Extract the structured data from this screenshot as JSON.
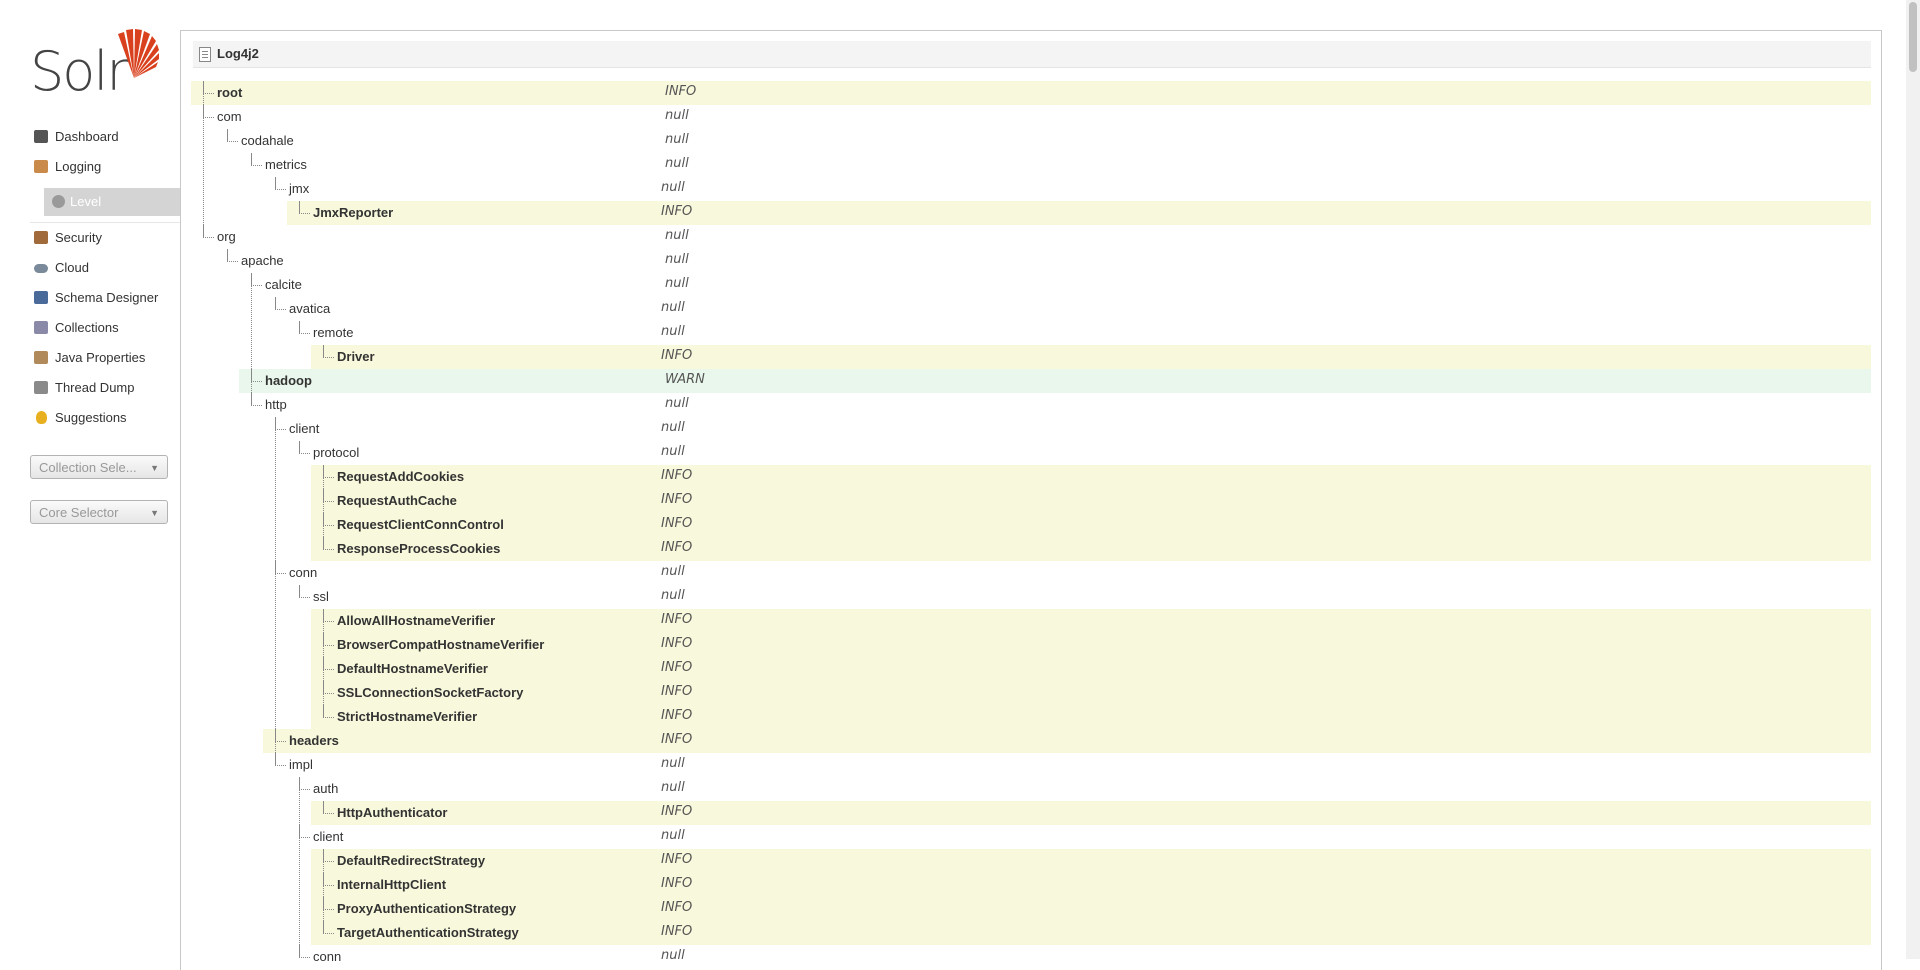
{
  "logo": {
    "text": "Solr"
  },
  "nav": [
    {
      "name": "nav-dashboard",
      "label": "Dashboard",
      "icon": "dashboard-icon",
      "color": "#555555"
    },
    {
      "name": "nav-logging",
      "label": "Logging",
      "icon": "logging-icon",
      "color": "#c98a4a"
    },
    {
      "name": "nav-level",
      "label": "Level",
      "icon": "gear-icon",
      "sub": true
    },
    {
      "name": "nav-security",
      "label": "Security",
      "icon": "security-icon",
      "color": "#a06a3a"
    },
    {
      "name": "nav-cloud",
      "label": "Cloud",
      "icon": "cloud-icon",
      "color": "#7a8a9a"
    },
    {
      "name": "nav-schema-designer",
      "label": "Schema Designer",
      "icon": "book-icon",
      "color": "#4a6a9a"
    },
    {
      "name": "nav-collections",
      "label": "Collections",
      "icon": "collections-icon",
      "color": "#8a8aa8"
    },
    {
      "name": "nav-java-properties",
      "label": "Java Properties",
      "icon": "java-icon",
      "color": "#b08a5a"
    },
    {
      "name": "nav-thread-dump",
      "label": "Thread Dump",
      "icon": "thread-dump-icon",
      "color": "#8a8a8a"
    },
    {
      "name": "nav-suggestions",
      "label": "Suggestions",
      "icon": "lightbulb-icon",
      "color": "#e8b020"
    }
  ],
  "selectors": {
    "collection": "Collection Sele...",
    "core": "Core Selector"
  },
  "panel": {
    "title": "Log4j2"
  },
  "colors": {
    "accent": "#d9411e",
    "set_row": "#f8f8dc",
    "warn_row": "#e9f7ec"
  },
  "tree": [
    {
      "label": "root",
      "level": "INFO",
      "depth": 0,
      "set": true,
      "hl": "set"
    },
    {
      "label": "com",
      "level": "null",
      "depth": 0
    },
    {
      "label": "codahale",
      "level": "null",
      "depth": 1
    },
    {
      "label": "metrics",
      "level": "null",
      "depth": 2
    },
    {
      "label": "jmx",
      "level": "null",
      "depth": 3
    },
    {
      "label": "JmxReporter",
      "level": "INFO",
      "depth": 4,
      "set": true,
      "hl": "set"
    },
    {
      "label": "org",
      "level": "null",
      "depth": 0
    },
    {
      "label": "apache",
      "level": "null",
      "depth": 1
    },
    {
      "label": "calcite",
      "level": "null",
      "depth": 2
    },
    {
      "label": "avatica",
      "level": "null",
      "depth": 3
    },
    {
      "label": "remote",
      "level": "null",
      "depth": 4
    },
    {
      "label": "Driver",
      "level": "INFO",
      "depth": 5,
      "set": true,
      "hl": "set"
    },
    {
      "label": "hadoop",
      "level": "WARN",
      "depth": 2,
      "set": true,
      "hl": "warn"
    },
    {
      "label": "http",
      "level": "null",
      "depth": 2
    },
    {
      "label": "client",
      "level": "null",
      "depth": 3
    },
    {
      "label": "protocol",
      "level": "null",
      "depth": 4
    },
    {
      "label": "RequestAddCookies",
      "level": "INFO",
      "depth": 5,
      "set": true,
      "hl": "set"
    },
    {
      "label": "RequestAuthCache",
      "level": "INFO",
      "depth": 5,
      "set": true,
      "hl": "set"
    },
    {
      "label": "RequestClientConnControl",
      "level": "INFO",
      "depth": 5,
      "set": true,
      "hl": "set"
    },
    {
      "label": "ResponseProcessCookies",
      "level": "INFO",
      "depth": 5,
      "set": true,
      "hl": "set"
    },
    {
      "label": "conn",
      "level": "null",
      "depth": 3
    },
    {
      "label": "ssl",
      "level": "null",
      "depth": 4
    },
    {
      "label": "AllowAllHostnameVerifier",
      "level": "INFO",
      "depth": 5,
      "set": true,
      "hl": "set"
    },
    {
      "label": "BrowserCompatHostnameVerifier",
      "level": "INFO",
      "depth": 5,
      "set": true,
      "hl": "set"
    },
    {
      "label": "DefaultHostnameVerifier",
      "level": "INFO",
      "depth": 5,
      "set": true,
      "hl": "set"
    },
    {
      "label": "SSLConnectionSocketFactory",
      "level": "INFO",
      "depth": 5,
      "set": true,
      "hl": "set"
    },
    {
      "label": "StrictHostnameVerifier",
      "level": "INFO",
      "depth": 5,
      "set": true,
      "hl": "set"
    },
    {
      "label": "headers",
      "level": "INFO",
      "depth": 3,
      "set": true,
      "hl": "set"
    },
    {
      "label": "impl",
      "level": "null",
      "depth": 3
    },
    {
      "label": "auth",
      "level": "null",
      "depth": 4
    },
    {
      "label": "HttpAuthenticator",
      "level": "INFO",
      "depth": 5,
      "set": true,
      "hl": "set"
    },
    {
      "label": "client",
      "level": "null",
      "depth": 4
    },
    {
      "label": "DefaultRedirectStrategy",
      "level": "INFO",
      "depth": 5,
      "set": true,
      "hl": "set"
    },
    {
      "label": "InternalHttpClient",
      "level": "INFO",
      "depth": 5,
      "set": true,
      "hl": "set"
    },
    {
      "label": "ProxyAuthenticationStrategy",
      "level": "INFO",
      "depth": 5,
      "set": true,
      "hl": "set"
    },
    {
      "label": "TargetAuthenticationStrategy",
      "level": "INFO",
      "depth": 5,
      "set": true,
      "hl": "set"
    },
    {
      "label": "conn",
      "level": "null",
      "depth": 4
    }
  ]
}
